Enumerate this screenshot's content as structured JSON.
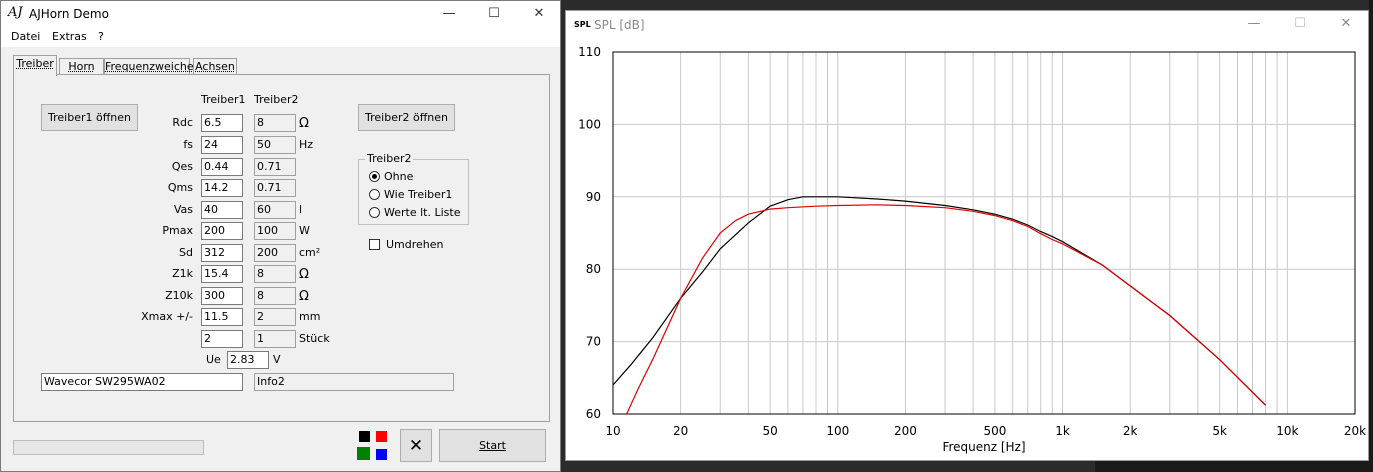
{
  "main_window": {
    "title": "AJHorn Demo",
    "logo": "AJ",
    "controls": {
      "minimize": "—",
      "maximize": "☐",
      "close": "✕"
    },
    "menu": [
      "Datei",
      "Extras",
      "?"
    ],
    "tabs": [
      "Treiber",
      "Horn",
      "Frequenzweiche",
      "Achsen"
    ],
    "active_tab": "Treiber",
    "headers": {
      "driver1": "Treiber1",
      "driver2": "Treiber2"
    },
    "buttons": {
      "open_driver1": "Treiber1 öffnen",
      "open_driver2": "Treiber2 öffnen",
      "start": "Start",
      "cancel_symbol": "✕"
    },
    "params": [
      {
        "label": "Rdc",
        "t1": "6.5",
        "t2": "8",
        "unit": "Ω"
      },
      {
        "label": "fs",
        "t1": "24",
        "t2": "50",
        "unit": "Hz"
      },
      {
        "label": "Qes",
        "t1": "0.44",
        "t2": "0.71",
        "unit": ""
      },
      {
        "label": "Qms",
        "t1": "14.2",
        "t2": "0.71",
        "unit": ""
      },
      {
        "label": "Vas",
        "t1": "40",
        "t2": "60",
        "unit": "l"
      },
      {
        "label": "Pmax",
        "t1": "200",
        "t2": "100",
        "unit": "W"
      },
      {
        "label": "Sd",
        "t1": "312",
        "t2": "200",
        "unit": "cm²"
      },
      {
        "label": "Z1k",
        "t1": "15.4",
        "t2": "8",
        "unit": "Ω"
      },
      {
        "label": "Z10k",
        "t1": "300",
        "t2": "8",
        "unit": "Ω"
      },
      {
        "label": "Xmax +/-",
        "t1": "11.5",
        "t2": "2",
        "unit": "mm"
      },
      {
        "label": "",
        "t1": "2",
        "t2": "1",
        "unit": "Stück"
      }
    ],
    "ue": {
      "label": "Ue",
      "value": "2.83",
      "unit": "V"
    },
    "driver_names": {
      "driver1": "Wavecor SW295WA02",
      "driver2": "Info2"
    },
    "treiber2_group": {
      "title": "Treiber2",
      "options": [
        "Ohne",
        "Wie Treiber1",
        "Werte lt. Liste"
      ],
      "selected": "Ohne"
    },
    "reverse_checkbox": {
      "label": "Umdrehen",
      "checked": false
    },
    "color_swatches": [
      "#000000",
      "#ff0000",
      "#008000",
      "#0000ff"
    ]
  },
  "chart_window": {
    "icon_text": "SPL",
    "title": "SPL [dB]",
    "controls": {
      "minimize": "—",
      "maximize": "☐",
      "close": "✕"
    }
  },
  "chart_data": {
    "type": "line",
    "title": "",
    "xlabel": "Frequenz [Hz]",
    "ylabel": "",
    "x_scale": "log",
    "xlim": [
      10,
      20000
    ],
    "ylim": [
      60,
      110
    ],
    "x_ticks": [
      10,
      20,
      50,
      100,
      200,
      500,
      1000,
      2000,
      5000,
      10000,
      20000
    ],
    "x_tick_labels": [
      "10",
      "20",
      "50",
      "100",
      "200",
      "500",
      "1k",
      "2k",
      "5k",
      "10k",
      "20k"
    ],
    "y_ticks": [
      60,
      70,
      80,
      90,
      100,
      110
    ],
    "grid": true,
    "series": [
      {
        "color": "#000000",
        "x": [
          10,
          12,
          15,
          20,
          25,
          30,
          40,
          50,
          60,
          70,
          80,
          100,
          150,
          200,
          300,
          400,
          500,
          600,
          700,
          800,
          900,
          1000,
          1500,
          2000,
          3000,
          5000,
          8000
        ],
        "y": [
          64,
          66.8,
          70.5,
          76,
          79.6,
          82.8,
          86.4,
          88.7,
          89.6,
          90,
          90,
          90,
          89.7,
          89.4,
          88.8,
          88.2,
          87.6,
          86.9,
          86.1,
          85.2,
          84.5,
          83.8,
          80.6,
          77.7,
          73.6,
          67.5,
          61.2
        ]
      },
      {
        "color": "#e00000",
        "x": [
          11.5,
          13,
          15,
          20,
          25,
          30,
          35,
          40,
          50,
          60,
          80,
          100,
          150,
          200,
          300,
          400,
          500,
          600,
          700,
          800,
          900,
          1000,
          1500,
          2000,
          3000,
          5000,
          8000
        ],
        "y": [
          60,
          63.6,
          67.5,
          76,
          81.5,
          85,
          86.7,
          87.6,
          88.3,
          88.5,
          88.7,
          88.8,
          88.9,
          88.8,
          88.5,
          88,
          87.4,
          86.7,
          85.9,
          84.9,
          84.1,
          83.5,
          80.6,
          77.7,
          73.6,
          67.5,
          61.2
        ]
      }
    ]
  }
}
